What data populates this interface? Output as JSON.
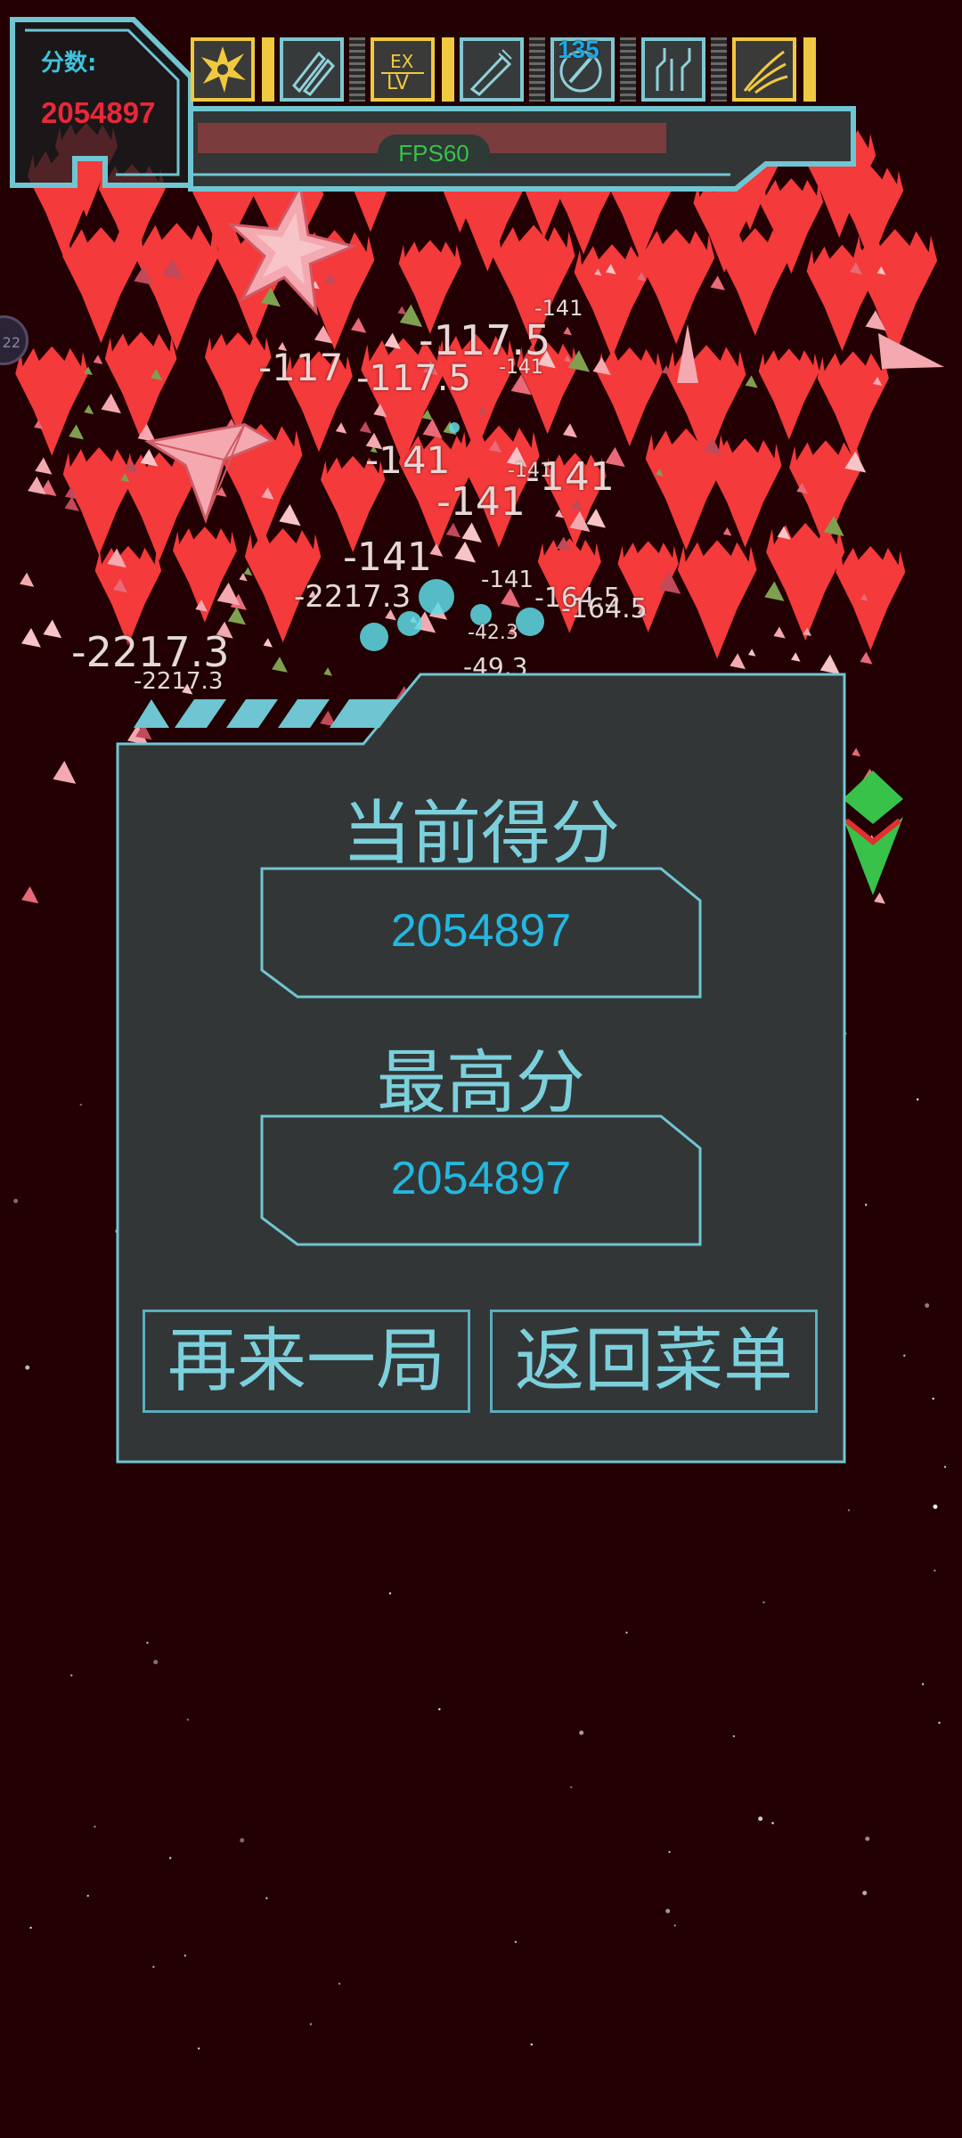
{
  "hud": {
    "score_label": "分数:",
    "score_value": "2054897",
    "skill_count": "135",
    "fps": "FPS60",
    "skills": [
      {
        "icon": "burst-icon"
      },
      {
        "icon": "twin-missiles-icon"
      },
      {
        "icon": "ex-level-icon"
      },
      {
        "icon": "missile-icon"
      },
      {
        "icon": "orbit-missile-icon"
      },
      {
        "icon": "circuit-icon"
      },
      {
        "icon": "wave-icon"
      }
    ]
  },
  "damage_numbers": [
    "-141",
    "-117.5",
    "-117",
    "-117.5",
    "-141",
    "-141",
    "-141",
    "-141",
    "-141",
    "-141",
    "-141",
    "-2217.3",
    "-164.5",
    "-164.5",
    "-42.3",
    "-49.3",
    "-2217.3",
    "-2217.3"
  ],
  "side_bubble": "22",
  "game_over": {
    "current_score_title": "当前得分",
    "current_score_value": "2054897",
    "high_score_title": "最高分",
    "high_score_value": "2054897",
    "retry_button": "再来一局",
    "menu_button": "返回菜单"
  },
  "colors": {
    "background": "#220003",
    "enemy": "#f43a3a",
    "accent_cyan": "#6fc6d2",
    "panel_bg": "#333637",
    "score_red": "#e8283a",
    "skill_gold": "#f0c940",
    "fps_green": "#38c24a"
  }
}
